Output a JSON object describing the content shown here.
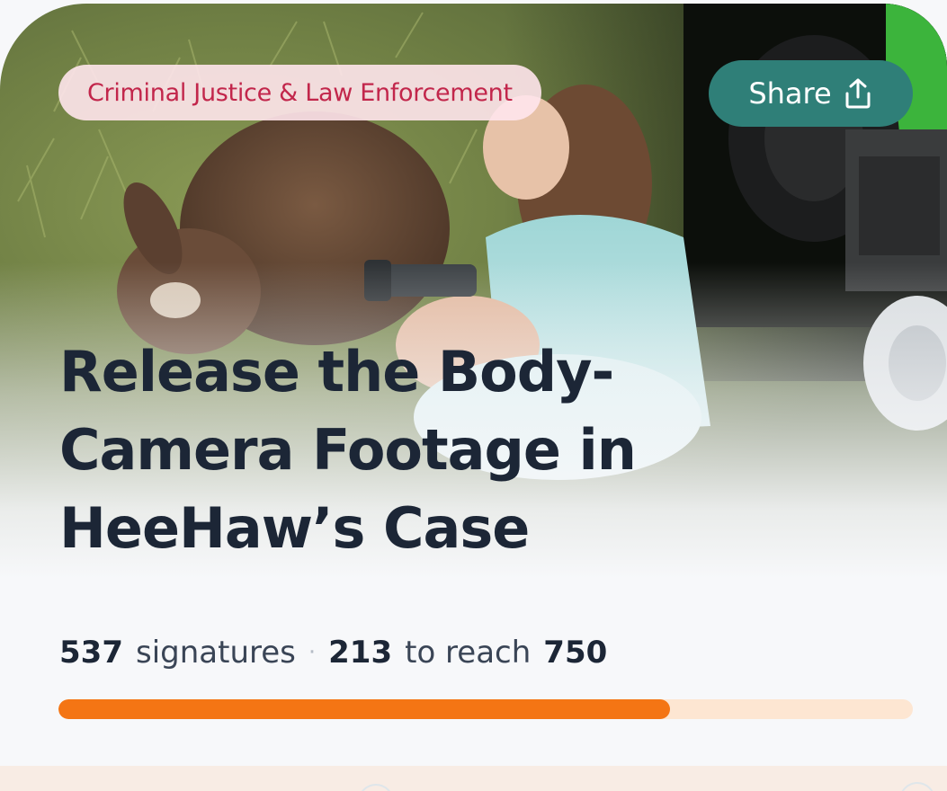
{
  "petition": {
    "category": "Criminal Justice & Law Enforcement",
    "share_label": "Share",
    "title": "Release the Body-Camera Footage in HeeHaw’s Case",
    "signatures_count": "537",
    "signatures_label": "signatures",
    "separator": "·",
    "remaining_count": "213",
    "remaining_label": "to reach",
    "goal": "750",
    "progress_fraction": 0.716
  },
  "colors": {
    "category_text": "#c2264b",
    "category_bg": "#ffe6ec",
    "share_bg": "#2f7f78",
    "title_text": "#1c2636",
    "progress_fill": "#f47514",
    "progress_track": "#fde6d2",
    "bottom_panel": "#f8ece4"
  },
  "icons": {
    "share": "share-upload-icon"
  },
  "hero_image": {
    "subject": "hero-photo"
  }
}
